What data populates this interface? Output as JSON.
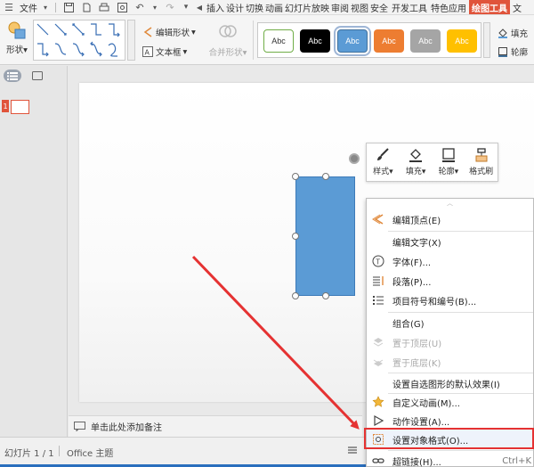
{
  "menubar": {
    "file_menu": "文件",
    "tabs": [
      "插入",
      "设计",
      "切换",
      "动画",
      "幻灯片放映",
      "审阅",
      "视图",
      "安全",
      "开发工具",
      "特色应用"
    ],
    "active_tab": "绘图工具",
    "trailing": "文"
  },
  "ribbon": {
    "shape_label": "形状",
    "edit_shape_label": "编辑形状",
    "text_box_label": "文本框",
    "merge_shape_label": "合并形状",
    "fill_label": "填充",
    "outline_label": "轮廓",
    "styles": [
      {
        "text": "Abc",
        "bg": "#ffffff",
        "fg": "#333333",
        "border": "#70ad47"
      },
      {
        "text": "Abc",
        "bg": "#000000",
        "fg": "#ffffff",
        "border": "#000000"
      },
      {
        "text": "Abc",
        "bg": "#5b9bd5",
        "fg": "#ffffff",
        "border": "#41719c"
      },
      {
        "text": "Abc",
        "bg": "#ed7d31",
        "fg": "#ffffff",
        "border": "#ed7d31"
      },
      {
        "text": "Abc",
        "bg": "#a5a5a5",
        "fg": "#ffffff",
        "border": "#a5a5a5"
      },
      {
        "text": "Abc",
        "bg": "#ffc000",
        "fg": "#ffffff",
        "border": "#ffc000"
      }
    ]
  },
  "slides_panel": {
    "thumbnail_number": "1"
  },
  "mini_toolbar": {
    "style_label": "样式",
    "fill_label": "填充",
    "outline_label": "轮廓",
    "format_painter_label": "格式刷"
  },
  "context_menu": {
    "items": [
      {
        "label": "编辑顶点(E)",
        "icon": "edit-points-icon"
      },
      {
        "label": "编辑文字(X)",
        "icon": ""
      },
      {
        "label": "字体(F)...",
        "icon": "font-icon"
      },
      {
        "label": "段落(P)...",
        "icon": "paragraph-icon"
      },
      {
        "label": "项目符号和编号(B)...",
        "icon": "bullets-icon"
      },
      {
        "label": "组合(G)",
        "icon": ""
      },
      {
        "label": "置于顶层(U)",
        "icon": "bring-to-front-icon",
        "disabled": true
      },
      {
        "label": "置于底层(K)",
        "icon": "send-to-back-icon",
        "disabled": true
      },
      {
        "label": "设置自选图形的默认效果(I)",
        "icon": ""
      },
      {
        "label": "自定义动画(M)...",
        "icon": "custom-animation-icon"
      },
      {
        "label": "动作设置(A)...",
        "icon": "action-settings-icon"
      },
      {
        "label": "设置对象格式(O)...",
        "icon": "format-object-icon",
        "highlight": true
      },
      {
        "label": "超链接(H)...",
        "icon": "hyperlink-icon",
        "shortcut": "Ctrl+K"
      }
    ]
  },
  "notes": {
    "placeholder": "单击此处添加备注"
  },
  "status": {
    "slide_info": "幻灯片 1 / 1",
    "theme": "Office 主题"
  }
}
